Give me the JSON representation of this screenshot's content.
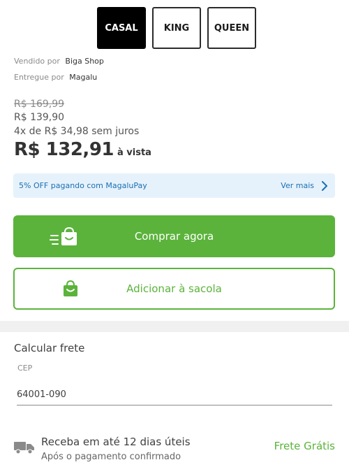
{
  "sizes": [
    {
      "label": "CASAL",
      "selected": true
    },
    {
      "label": "KING",
      "selected": false
    },
    {
      "label": "QUEEN",
      "selected": false
    }
  ],
  "seller": {
    "sold_by_label": "Vendido por",
    "sold_by_value": "Biga Shop",
    "delivered_by_label": "Entregue por",
    "delivered_by_value": "Magalu"
  },
  "pricing": {
    "original_price": "R$ 169,99",
    "price": "R$ 139,90",
    "installments": "4x de R$ 34,98 sem juros",
    "cash_price": "R$ 132,91",
    "cash_suffix": "à vista"
  },
  "promo": {
    "text": "5% OFF pagando com MagaluPay",
    "link": "Ver mais"
  },
  "actions": {
    "buy_now": "Comprar agora",
    "add_to_bag": "Adicionar à sacola"
  },
  "freight": {
    "title": "Calcular frete",
    "cep_label": "CEP",
    "cep_value": "64001-090",
    "delivery_title": "Receba em até 12 dias úteis",
    "delivery_subtitle": "Após o pagamento confirmado",
    "shipping_price": "Frete Grátis"
  },
  "icons": {
    "buy_now": "fast-shopping-bag-icon",
    "add_to_bag": "shopping-bag-icon",
    "delivery": "truck-icon",
    "promo_link": "chevron-right-icon"
  },
  "colors": {
    "primary_green": "#5bb33b",
    "promo_bg": "#e6f2fb",
    "promo_text": "#1a6fb3",
    "selected_size_bg": "#000000"
  }
}
